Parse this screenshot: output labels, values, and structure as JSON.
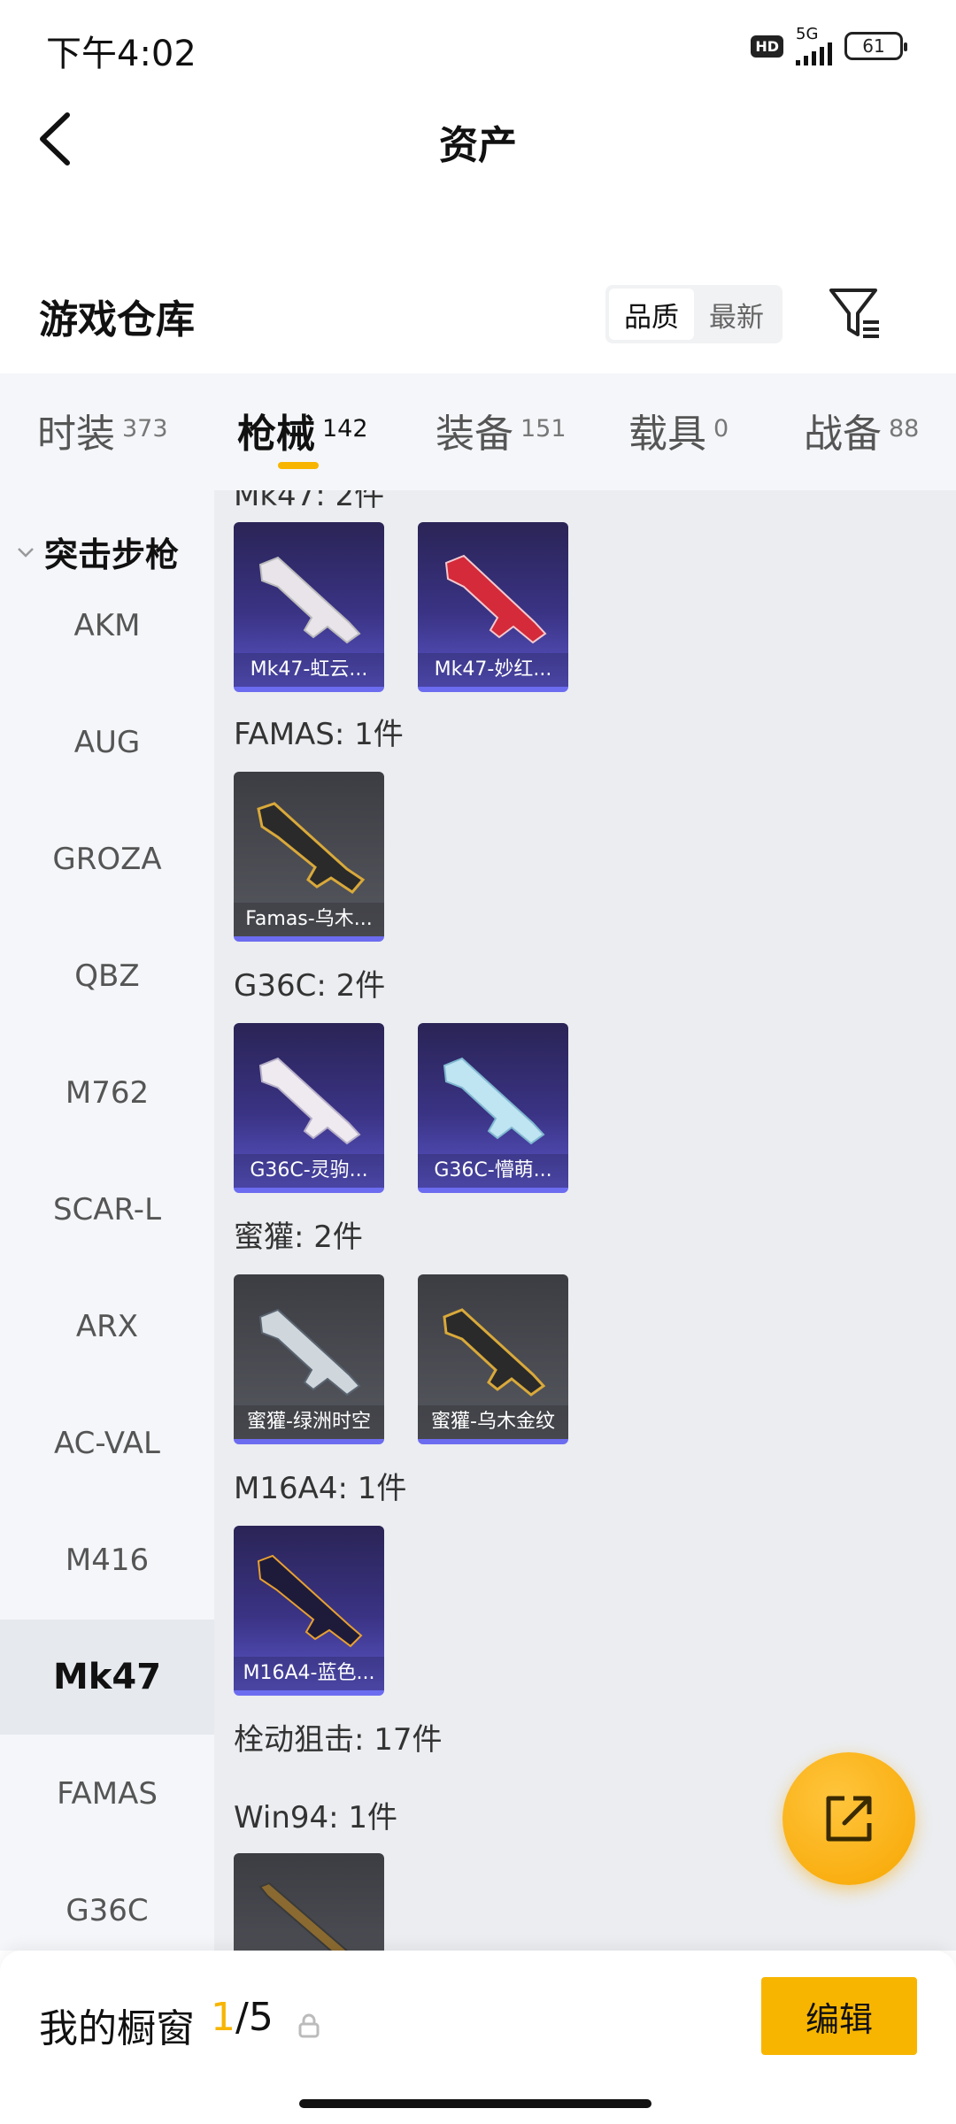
{
  "status_bar": {
    "time": "下午4:02",
    "hd": "HD",
    "network": "5G",
    "battery": "61"
  },
  "header": {
    "title": "资产"
  },
  "warehouse": {
    "title": "游戏仓库",
    "sort_options": [
      "品质",
      "最新"
    ],
    "active_sort": "品质"
  },
  "tabs": [
    {
      "label": "时装",
      "count": "373"
    },
    {
      "label": "枪械",
      "count": "142"
    },
    {
      "label": "装备",
      "count": "151"
    },
    {
      "label": "载具",
      "count": "0"
    },
    {
      "label": "战备",
      "count": "88"
    }
  ],
  "active_tab": "枪械",
  "sidebar": {
    "group": "突击步枪",
    "items": [
      "AKM",
      "AUG",
      "GROZA",
      "QBZ",
      "M762",
      "SCAR-L",
      "ARX",
      "AC-VAL",
      "M416",
      "Mk47",
      "FAMAS",
      "G36C"
    ],
    "active": "Mk47"
  },
  "sections": [
    {
      "label": "Mk47: 2件",
      "items": [
        {
          "name": "Mk47-虹云...",
          "rarity": "purple"
        },
        {
          "name": "Mk47-妙红...",
          "rarity": "purple"
        }
      ]
    },
    {
      "label": "FAMAS: 1件",
      "items": [
        {
          "name": "Famas-乌木...",
          "rarity": "gray"
        }
      ]
    },
    {
      "label": "G36C: 2件",
      "items": [
        {
          "name": "G36C-灵驹...",
          "rarity": "purple"
        },
        {
          "name": "G36C-懵萌...",
          "rarity": "purple"
        }
      ]
    },
    {
      "label": "蜜獾: 2件",
      "items": [
        {
          "name": "蜜獾-绿洲时空",
          "rarity": "gray"
        },
        {
          "name": "蜜獾-乌木金纹",
          "rarity": "gray"
        }
      ]
    },
    {
      "label": "M16A4: 1件",
      "items": [
        {
          "name": "M16A4-蓝色...",
          "rarity": "purple"
        }
      ]
    },
    {
      "label": "栓动狙击: 17件"
    },
    {
      "label": "Win94: 1件",
      "items": [
        {
          "name": "",
          "rarity": "gray"
        }
      ]
    }
  ],
  "bottom_bar": {
    "title": "我的橱窗",
    "current": "1",
    "total": "/5",
    "edit_label": "编辑"
  },
  "colors": {
    "accent": "#f7b500",
    "rarity_purple": "#3a3384",
    "rarity_underline": "#6c6cf0"
  }
}
